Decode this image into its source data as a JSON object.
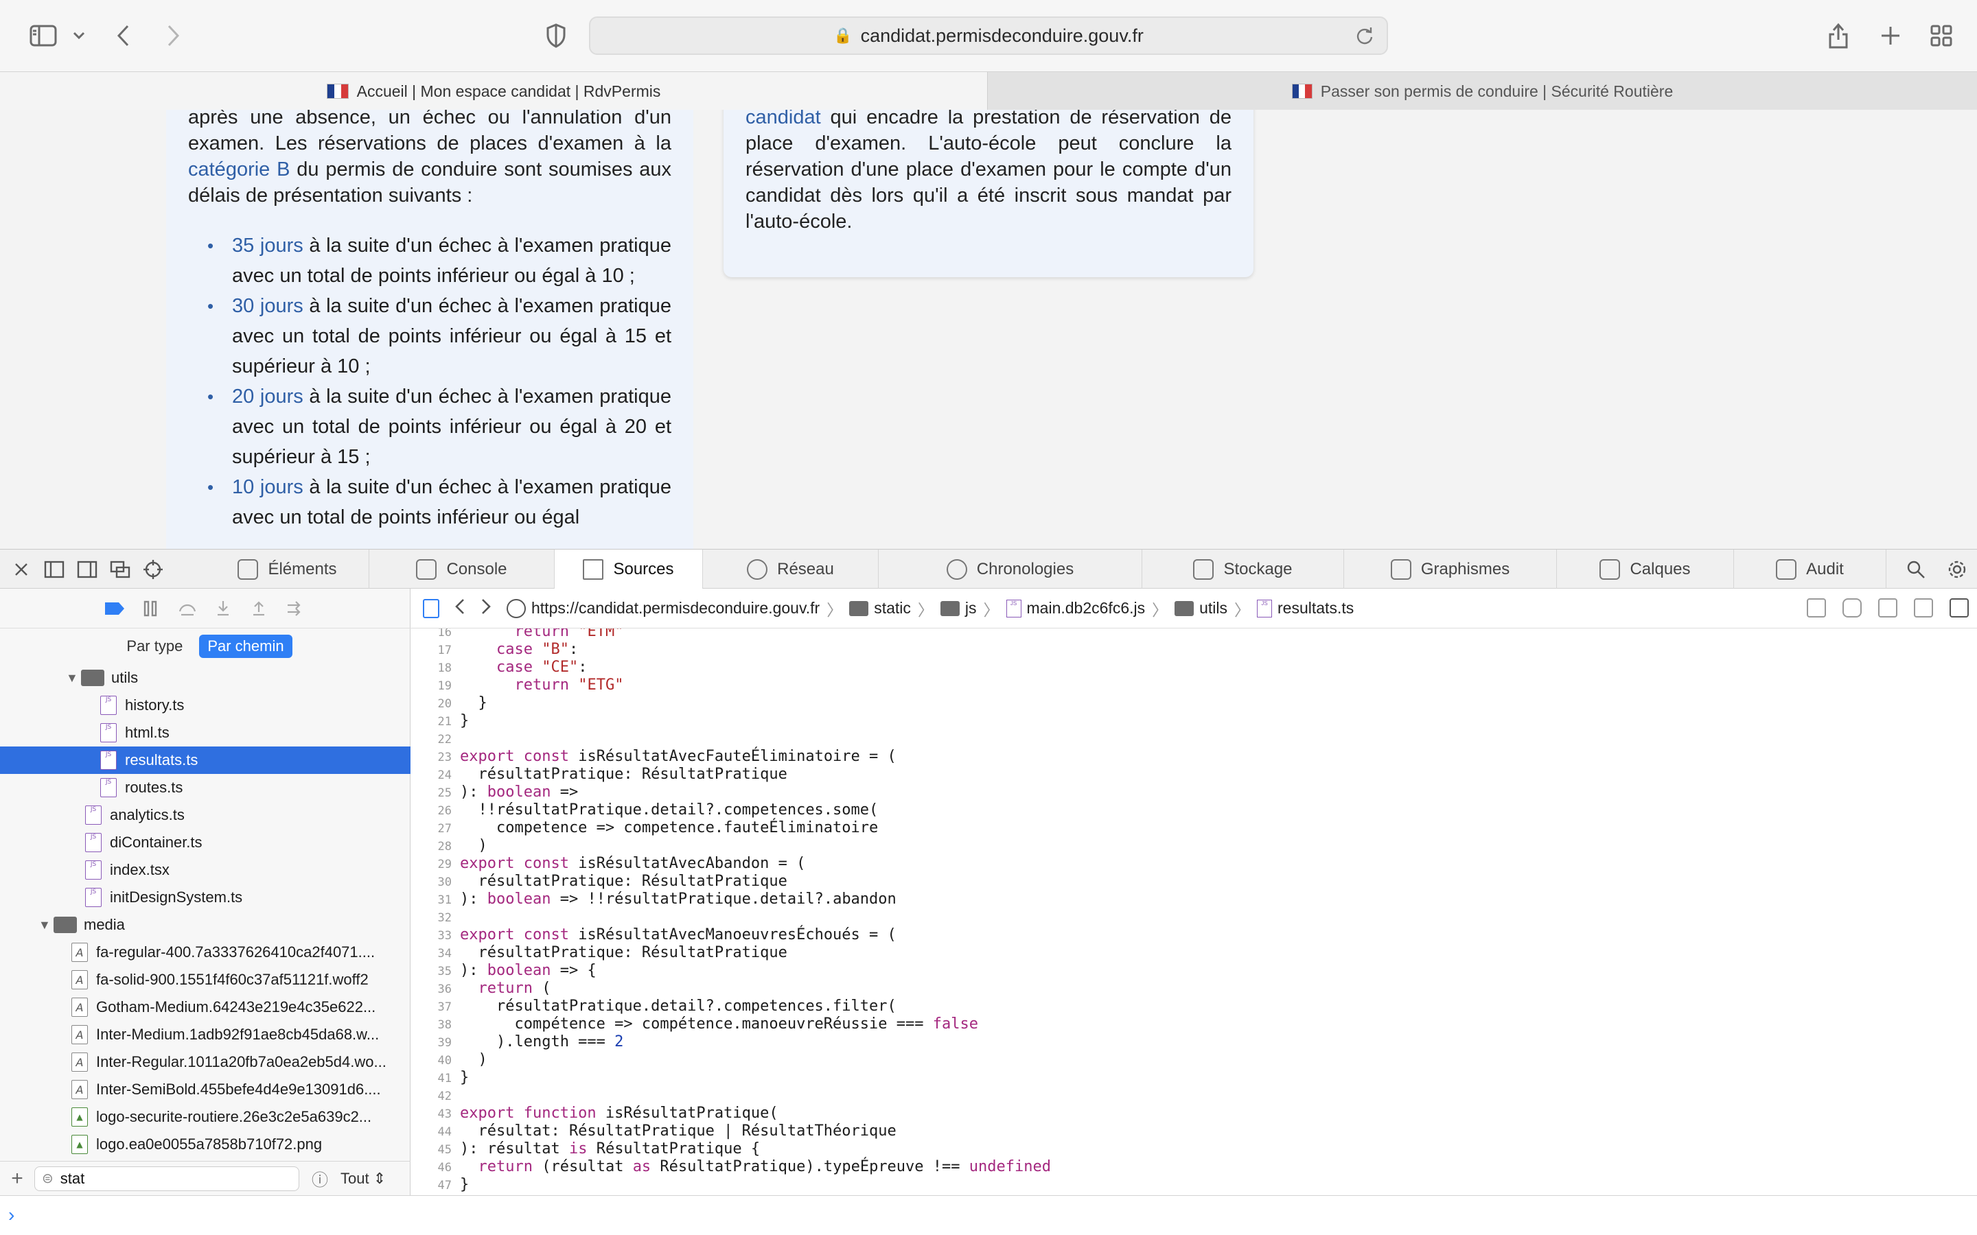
{
  "browser": {
    "url": "candidat.permisdeconduire.gouv.fr",
    "tabs": [
      {
        "label": "Accueil | Mon espace candidat | RdvPermis",
        "active": true
      },
      {
        "label": "Passer son permis de conduire | Sécurité Routière",
        "active": false
      }
    ]
  },
  "page": {
    "left_intro_1": "après une absence, un échec ou l'annulation d'un examen. Les réservations de places d'examen à la",
    "left_intro_link": "catégorie B",
    "left_intro_2": "du permis de conduire sont soumises aux délais de présentation suivants :",
    "bullets": [
      {
        "days": "35 jours",
        "text": "à la suite d'un échec à l'examen pratique avec un total de points inférieur ou égal à 10 ;"
      },
      {
        "days": "30 jours",
        "text": "à la suite d'un échec à l'examen pratique avec un total de points inférieur ou égal à 15 et supérieur à 10 ;"
      },
      {
        "days": "20 jours",
        "text": "à la suite d'un échec à l'examen pratique avec un total de points inférieur ou égal à 20 et supérieur à 15 ;"
      },
      {
        "days": "10 jours",
        "text": "à la suite d'un échec à l'examen pratique avec un total de points inférieur ou égal"
      }
    ],
    "right_link": "candidat",
    "right_text": "qui encadre la prestation de réservation de place d'examen. L'auto-école peut conclure la réservation d'une place d'examen pour le compte d'un candidat dès lors qu'il a été inscrit sous mandat par l'auto-école."
  },
  "inspector": {
    "tabs": [
      "Éléments",
      "Console",
      "Sources",
      "Réseau",
      "Chronologies",
      "Stockage",
      "Graphismes",
      "Calques",
      "Audit"
    ],
    "selected_tab": "Sources",
    "filter_modes": {
      "by_type": "Par type",
      "by_path": "Par chemin"
    },
    "tree": [
      {
        "label": "utils",
        "kind": "folder",
        "depth": 1
      },
      {
        "label": "history.ts",
        "kind": "js",
        "depth": 2
      },
      {
        "label": "html.ts",
        "kind": "js",
        "depth": 2
      },
      {
        "label": "resultats.ts",
        "kind": "js",
        "depth": 2,
        "selected": true
      },
      {
        "label": "routes.ts",
        "kind": "js",
        "depth": 2
      },
      {
        "label": "analytics.ts",
        "kind": "js",
        "depth": 1
      },
      {
        "label": "diContainer.ts",
        "kind": "js",
        "depth": 1
      },
      {
        "label": "index.tsx",
        "kind": "js",
        "depth": 1
      },
      {
        "label": "initDesignSystem.ts",
        "kind": "js",
        "depth": 1
      },
      {
        "label": "media",
        "kind": "folder",
        "depth": 0
      },
      {
        "label": "fa-regular-400.7a3337626410ca2f4071....",
        "kind": "font",
        "depth": 1
      },
      {
        "label": "fa-solid-900.1551f4f60c37af51121f.woff2",
        "kind": "font",
        "depth": 1
      },
      {
        "label": "Gotham-Medium.64243e219e4c35e622...",
        "kind": "font",
        "depth": 1
      },
      {
        "label": "Inter-Medium.1adb92f91ae8cb45da68.w...",
        "kind": "font",
        "depth": 1
      },
      {
        "label": "Inter-Regular.1011a20fb7a0ea2eb5d4.wo...",
        "kind": "font",
        "depth": 1
      },
      {
        "label": "Inter-SemiBold.455befe4d4e9e13091d6....",
        "kind": "font",
        "depth": 1
      },
      {
        "label": "logo-securite-routiere.26e3c2e5a639c2...",
        "kind": "img",
        "depth": 1
      },
      {
        "label": "logo.ea0e0055a7858b710f72.png",
        "kind": "img",
        "depth": 1
      }
    ],
    "filter_text": "stat",
    "filter_scope": "Tout",
    "breadcrumbs": [
      "https://candidat.permisdeconduire.gouv.fr",
      "static",
      "js",
      "main.db2c6fc6.js",
      "utils",
      "resultats.ts"
    ],
    "code_lines": [
      {
        "n": "16",
        "html": "      <span class=\"kw\">return</span> <span class=\"str\">\"ETM\"</span>"
      },
      {
        "n": "17",
        "html": "    <span class=\"kw\">case</span> <span class=\"str\">\"B\"</span>:"
      },
      {
        "n": "18",
        "html": "    <span class=\"kw\">case</span> <span class=\"str\">\"CE\"</span>:"
      },
      {
        "n": "19",
        "html": "      <span class=\"kw\">return</span> <span class=\"str\">\"ETG\"</span>"
      },
      {
        "n": "20",
        "html": "  }"
      },
      {
        "n": "21",
        "html": "}"
      },
      {
        "n": "22",
        "html": ""
      },
      {
        "n": "23",
        "html": "<span class=\"kw\">export const</span> isRésultatAvecFauteÉliminatoire = ("
      },
      {
        "n": "24",
        "html": "  résultatPratique: RésultatPratique"
      },
      {
        "n": "25",
        "html": "): <span class=\"kw\">boolean</span> =>"
      },
      {
        "n": "26",
        "html": "  !!résultatPratique.detail?.competences.some("
      },
      {
        "n": "27",
        "html": "    competence => competence.fauteÉliminatoire"
      },
      {
        "n": "28",
        "html": "  )"
      },
      {
        "n": "29",
        "html": "<span class=\"kw\">export const</span> isRésultatAvecAbandon = ("
      },
      {
        "n": "30",
        "html": "  résultatPratique: RésultatPratique"
      },
      {
        "n": "31",
        "html": "): <span class=\"kw\">boolean</span> => !!résultatPratique.detail?.abandon"
      },
      {
        "n": "32",
        "html": ""
      },
      {
        "n": "33",
        "html": "<span class=\"kw\">export const</span> isRésultatAvecManoeuvresÉchoués = ("
      },
      {
        "n": "34",
        "html": "  résultatPratique: RésultatPratique"
      },
      {
        "n": "35",
        "html": "): <span class=\"kw\">boolean</span> => {"
      },
      {
        "n": "36",
        "html": "  <span class=\"kw\">return</span> ("
      },
      {
        "n": "37",
        "html": "    résultatPratique.detail?.competences.filter("
      },
      {
        "n": "38",
        "html": "      compétence => compétence.manoeuvreRéussie === <span class=\"kw\">false</span>"
      },
      {
        "n": "39",
        "html": "    ).length === <span class=\"num\">2</span>"
      },
      {
        "n": "40",
        "html": "  )"
      },
      {
        "n": "41",
        "html": "}"
      },
      {
        "n": "42",
        "html": ""
      },
      {
        "n": "43",
        "html": "<span class=\"kw\">export function</span> isRésultatPratique("
      },
      {
        "n": "44",
        "html": "  résultat: RésultatPratique | RésultatThéorique"
      },
      {
        "n": "45",
        "html": "): résultat <span class=\"kw\">is</span> RésultatPratique {"
      },
      {
        "n": "46",
        "html": "  <span class=\"kw\">return</span> (résultat <span class=\"kw\">as</span> RésultatPratique).typeÉpreuve !== <span class=\"kw\">undefined</span>"
      },
      {
        "n": "47",
        "html": "}"
      }
    ]
  },
  "colors": {
    "link": "#2f5fa6",
    "selection": "#2f6fe0",
    "keyword": "#a4287f",
    "string": "#b22a2a"
  }
}
